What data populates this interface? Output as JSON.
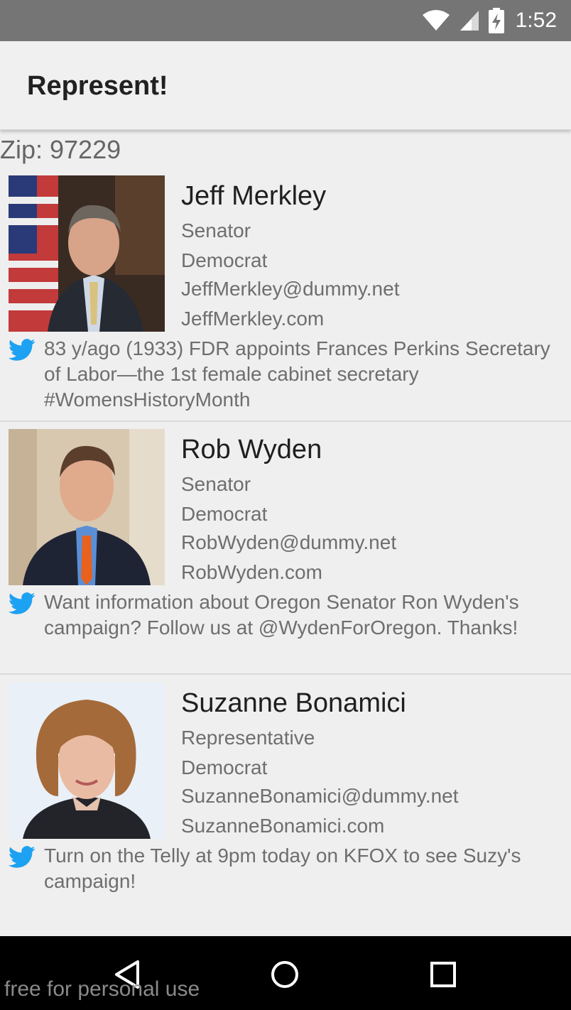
{
  "status_bar": {
    "time": "1:52"
  },
  "app_bar": {
    "title": "Represent!"
  },
  "zip_label": "Zip: 97229",
  "reps": [
    {
      "name": "Jeff Merkley",
      "title": "Senator",
      "party": "Democrat",
      "email": "JeffMerkley@dummy.net",
      "website": "JeffMerkley.com",
      "tweet": "83 y/ago (1933) FDR appoints Frances Perkins Secretary of Labor—the 1st female cabinet secretary #WomensHistoryMonth"
    },
    {
      "name": "Rob Wyden",
      "title": "Senator",
      "party": "Democrat",
      "email": "RobWyden@dummy.net",
      "website": "RobWyden.com",
      "tweet": "Want information about Oregon Senator Ron Wyden's campaign? Follow us at @WydenForOregon. Thanks!"
    },
    {
      "name": "Suzanne Bonamici",
      "title": "Representative",
      "party": "Democrat",
      "email": "SuzanneBonamici@dummy.net",
      "website": "SuzanneBonamici.com",
      "tweet": "Turn on the Telly at 9pm today on KFOX to see Suzy's campaign!"
    }
  ],
  "watermark": "free for personal use",
  "colors": {
    "status_bar": "#757575",
    "background": "#efefef",
    "twitter_blue": "#1da1f2",
    "nav_bar": "#000000"
  },
  "icons": [
    "wifi-icon",
    "signal-icon",
    "battery-charging-icon",
    "twitter-bird-icon",
    "back-icon",
    "home-icon",
    "recents-icon"
  ]
}
